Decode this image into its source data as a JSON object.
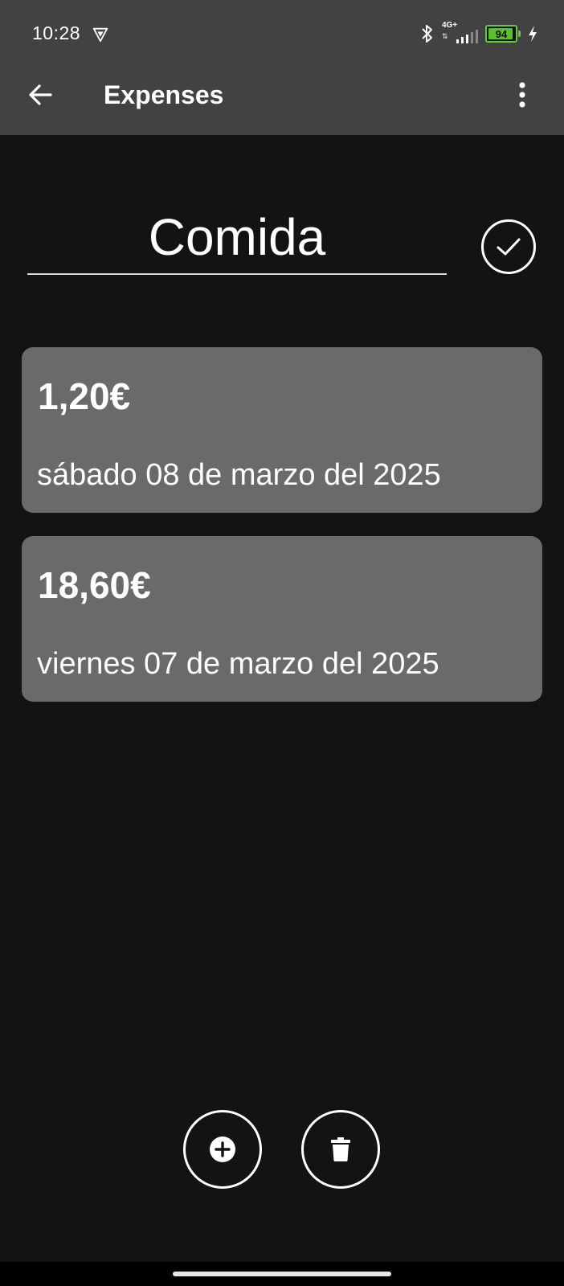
{
  "status_bar": {
    "time": "10:28",
    "network_label": "4G+",
    "battery_level": "94",
    "battery_fraction": 0.94
  },
  "app_bar": {
    "title": "Expenses",
    "back_icon": "arrow-left-icon",
    "menu_icon": "more-vert-icon"
  },
  "category": {
    "name": "Comida",
    "confirm_icon": "check-icon"
  },
  "expenses": [
    {
      "amount": "1,20€",
      "date": "sábado 08 de marzo del 2025"
    },
    {
      "amount": "18,60€",
      "date": "viernes 07 de marzo del 2025"
    }
  ],
  "actions": {
    "add_icon": "add-circle-icon",
    "delete_icon": "trash-icon"
  },
  "colors": {
    "app_bar": "#424242",
    "background": "#131313",
    "card": "#6a6a6a",
    "battery": "#57c12e"
  }
}
